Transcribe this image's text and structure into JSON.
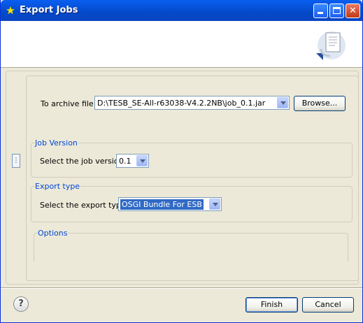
{
  "window": {
    "title": "Export Jobs"
  },
  "banner": {
    "icon": "export-wizard-icon"
  },
  "archive": {
    "label": "To archive file:",
    "value": "D:\\TESB_SE-All-r63038-V4.2.2NB\\job_0.1.jar",
    "browse_label": "Browse..."
  },
  "job_version": {
    "group_title": "Job Version",
    "label": "Select the job version",
    "value": "0.1"
  },
  "export_type": {
    "group_title": "Export type",
    "label": "Select the export type",
    "value": "OSGI Bundle For ESB"
  },
  "options": {
    "group_title": "Options"
  },
  "footer": {
    "finish_label": "Finish",
    "cancel_label": "Cancel",
    "help_icon": "help-icon"
  },
  "colors": {
    "titlebar": "#0a5ff0",
    "group_title": "#0046d5",
    "selection": "#316ac5"
  }
}
